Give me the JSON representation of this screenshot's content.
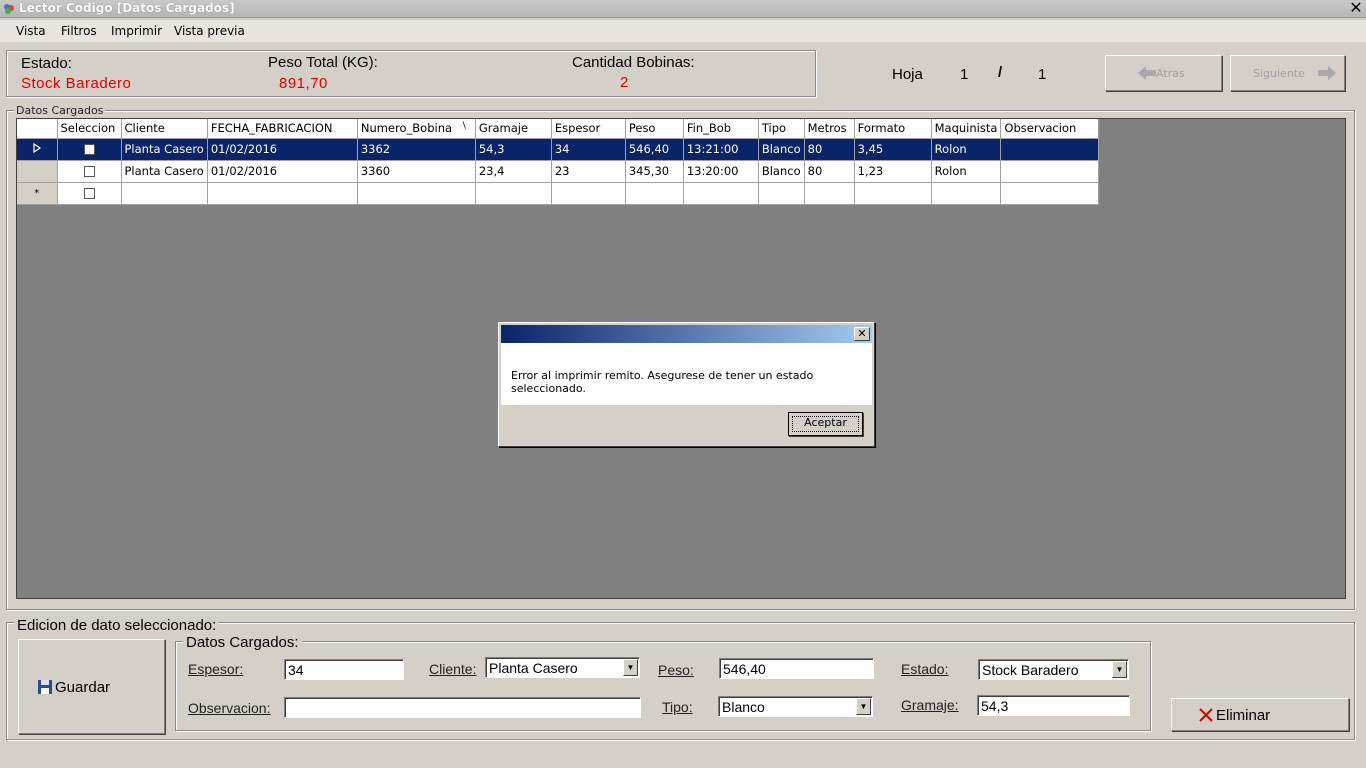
{
  "window": {
    "title": "Lector Codigo [Datos Cargados]",
    "close_glyph": "✕"
  },
  "menu": [
    {
      "label": "Vista"
    },
    {
      "label": "Filtros"
    },
    {
      "label": "Imprimir"
    },
    {
      "label": "Vista previa"
    }
  ],
  "summary": {
    "estado_label": "Estado:",
    "estado_value": "Stock Baradero",
    "peso_label": "Peso Total (KG):",
    "peso_value": "891,70",
    "cantidad_label": "Cantidad Bobinas:",
    "cantidad_value": "2"
  },
  "paging": {
    "hoja_label": "Hoja",
    "current": "1",
    "separator": "/",
    "total": "1",
    "prev_label": "Atras",
    "next_label": "Siguiente"
  },
  "grid": {
    "group_label": "Datos Cargados",
    "columns": [
      "Seleccion",
      "Cliente",
      "FECHA_FABRICACION",
      "Numero_Bobina",
      "Gramaje",
      "Espesor",
      "Peso",
      "Fin_Bob",
      "Tipo",
      "Metros",
      "Formato",
      "Maquinista",
      "Observacion"
    ],
    "sort_glyph": "\\",
    "new_row_marker": "*",
    "rows": [
      [
        "Planta Casero",
        "01/02/2016",
        "3362",
        "54,3",
        "34",
        "546,40",
        "13:21:00",
        "Blanco",
        "80",
        "3,45",
        "Rolon",
        ""
      ],
      [
        "Planta Casero",
        "01/02/2016",
        "3360",
        "23,4",
        "23",
        "345,30",
        "13:20:00",
        "Blanco",
        "80",
        "1,23",
        "Rolon",
        ""
      ]
    ]
  },
  "dialog": {
    "close_glyph": "✕",
    "message": "Error al imprimir remito. Asegurese de tener un estado seleccionado.",
    "ok_label": "Aceptar"
  },
  "edit": {
    "group_label": "Edicion de dato seleccionado:",
    "inner_label": "Datos Cargados:",
    "save_label": "Guardar",
    "delete_label": "Eliminar",
    "espesor_label": "Espesor:",
    "espesor_value": "34",
    "cliente_label": "Cliente:",
    "cliente_value": "Planta Casero",
    "peso_label": "Peso:",
    "peso_value": "546,40",
    "estado_label": "Estado:",
    "estado_value": "Stock Baradero",
    "observacion_label": "Observacion:",
    "observacion_value": "",
    "tipo_label": "Tipo:",
    "tipo_value": "Blanco",
    "gramaje_label": "Gramaje:",
    "gramaje_value": "54,3"
  },
  "colors": {
    "accent_red": "#e00000",
    "selection": "#0a246a"
  }
}
